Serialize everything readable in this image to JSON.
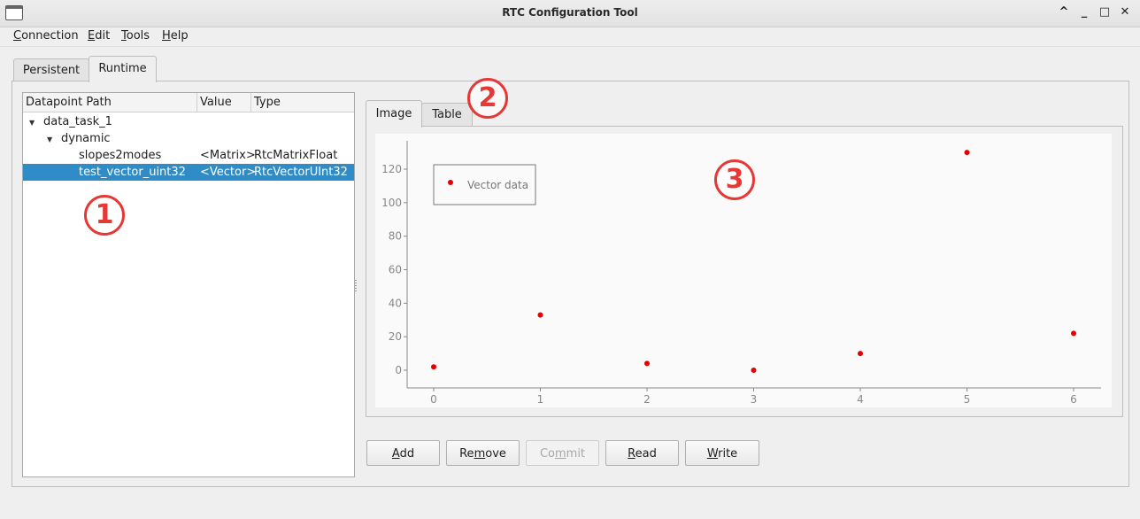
{
  "window": {
    "title": "RTC Configuration Tool"
  },
  "menu": [
    {
      "pre": "",
      "key": "C",
      "post": "onnection"
    },
    {
      "pre": "",
      "key": "E",
      "post": "dit"
    },
    {
      "pre": "",
      "key": "T",
      "post": "ools"
    },
    {
      "pre": "",
      "key": "H",
      "post": "elp"
    }
  ],
  "top_tabs": [
    "Persistent",
    "Runtime"
  ],
  "tree": {
    "columns": [
      "Datapoint Path",
      "Value",
      "Type"
    ],
    "rows": [
      {
        "path": "data_task_1",
        "value": "",
        "type": ""
      },
      {
        "path": "dynamic",
        "value": "",
        "type": ""
      },
      {
        "path": "slopes2modes",
        "value": "<Matrix>",
        "type": "RtcMatrixFloat"
      },
      {
        "path": "test_vector_uint32",
        "value": "<Vector>",
        "type": "RtcVectorUInt32"
      }
    ]
  },
  "view_tabs": [
    "Image",
    "Table"
  ],
  "chart_data": {
    "type": "scatter",
    "x": [
      0,
      1,
      2,
      3,
      4,
      5,
      6
    ],
    "y": [
      2,
      33,
      4,
      0,
      10,
      130,
      22
    ],
    "series": [
      {
        "name": "Vector data",
        "color": "#e30000"
      }
    ],
    "xlim": [
      -0.25,
      6.25
    ],
    "ylim": [
      -10,
      150
    ],
    "xticks": [
      "0",
      "1",
      "2",
      "3",
      "4",
      "5",
      "6"
    ],
    "yticks": [
      "0",
      "20",
      "40",
      "60",
      "80",
      "100",
      "120"
    ],
    "legend": "top-left",
    "grid": false
  },
  "buttons": [
    {
      "pre": "",
      "key": "A",
      "post": "dd"
    },
    {
      "pre": "Re",
      "key": "m",
      "post": "ove"
    },
    {
      "pre": "Co",
      "key": "m",
      "post": "mit"
    },
    {
      "pre": "",
      "key": "R",
      "post": "ead"
    },
    {
      "pre": "",
      "key": "W",
      "post": "rite"
    }
  ],
  "callouts": [
    "1",
    "2",
    "3"
  ]
}
